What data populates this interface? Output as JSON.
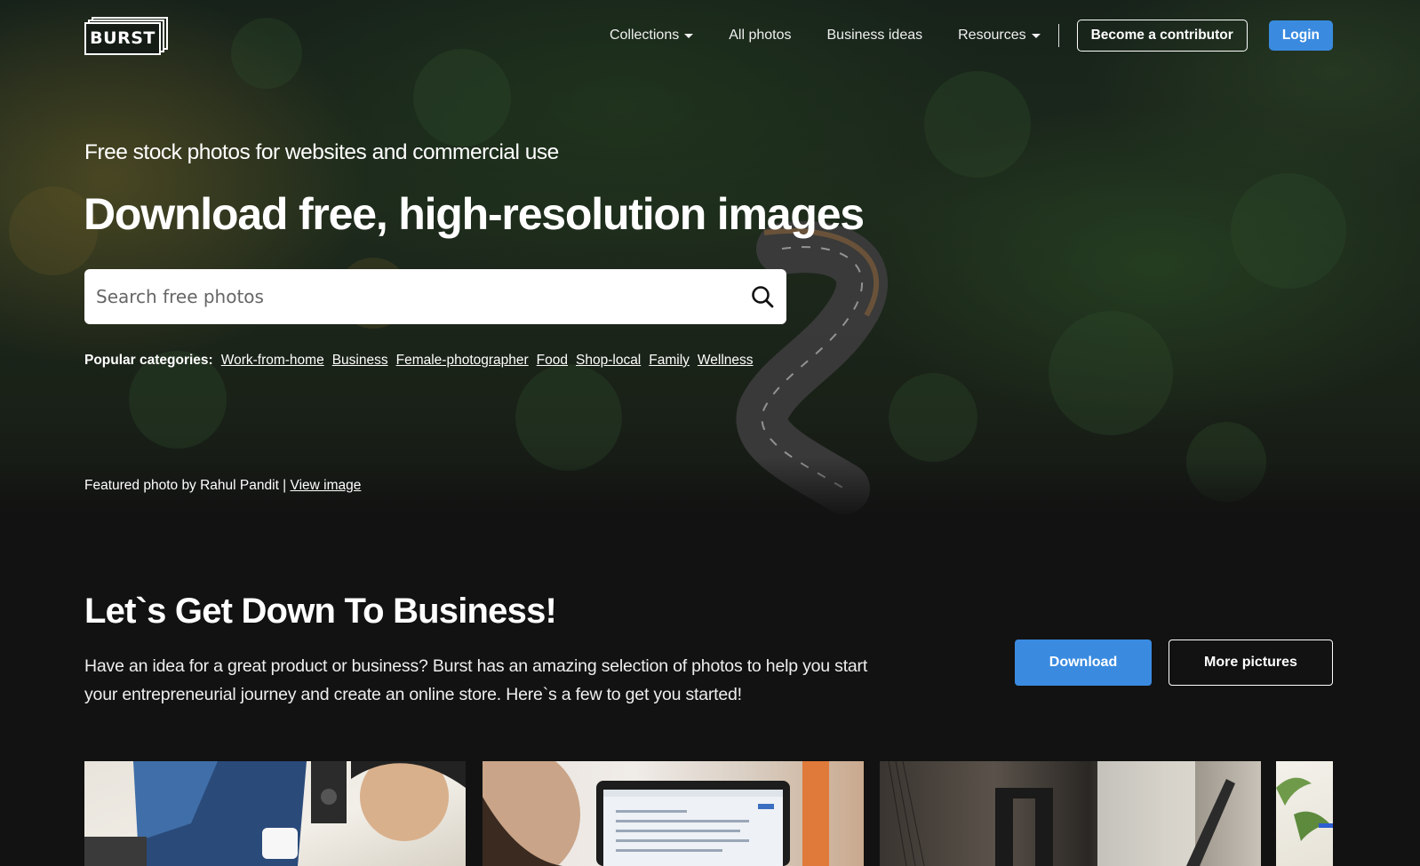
{
  "brand": {
    "logo_text": "BURST"
  },
  "nav": {
    "items": [
      {
        "label": "Collections",
        "dropdown": true
      },
      {
        "label": "All photos",
        "dropdown": false
      },
      {
        "label": "Business ideas",
        "dropdown": false
      },
      {
        "label": "Resources",
        "dropdown": true
      }
    ],
    "contributor_label": "Become a contributor",
    "login_label": "Login"
  },
  "hero": {
    "subtitle": "Free stock photos for websites and commercial use",
    "title": "Download free, high-resolution images",
    "search_placeholder": "Search free photos",
    "search_value": "",
    "categories_label": "Popular categories:",
    "categories": [
      "Work-from-home",
      "Business",
      "Female-photographer",
      "Food",
      "Shop-local",
      "Family",
      "Wellness"
    ],
    "featured_text": "Featured photo by Rahul Pandit | ",
    "view_image_label": "View image"
  },
  "section": {
    "title": "Let`s Get Down To Business!",
    "description": "Have an idea for a great product or business? Burst has an amazing selection of photos to help you start your entrepreneurial journey and create an online store. Here`s a few to get you started!",
    "download_label": "Download",
    "more_label": "More pictures"
  },
  "colors": {
    "accent": "#3a8be0",
    "page_background": "#121212",
    "text": "#ffffff"
  },
  "icons": [
    "search-icon",
    "chevron-down-icon"
  ]
}
